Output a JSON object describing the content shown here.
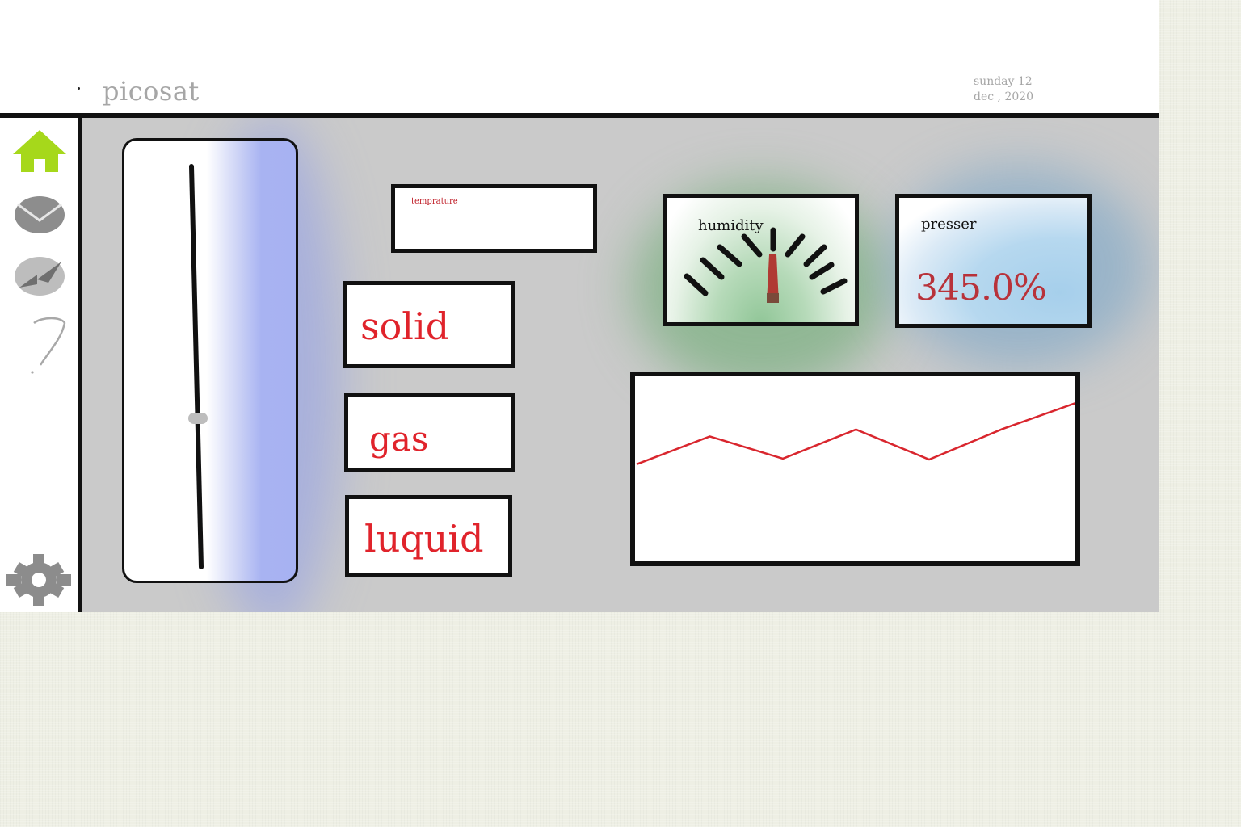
{
  "header": {
    "app_title": "picosat",
    "date_line1": "sunday 12",
    "date_line2": "dec , 2020"
  },
  "sidebar": {
    "items": [
      {
        "icon": "home-icon",
        "color": "#a6d81b"
      },
      {
        "icon": "mail-icon",
        "color": "#8a8a8a"
      },
      {
        "icon": "compass-icon",
        "color": "#8a8a8a"
      },
      {
        "icon": "question-icon",
        "color": "#8a8a8a"
      },
      {
        "icon": "gear-icon",
        "color": "#8a8a8a"
      }
    ]
  },
  "slider": {
    "level": 0.37
  },
  "temperature": {
    "label": "temprature"
  },
  "phases": {
    "solid": "solid",
    "gas": "gas",
    "liquid": "luquid"
  },
  "humidity": {
    "label": "humidity"
  },
  "pressure": {
    "label": "presser",
    "value": "345.0%"
  },
  "colors": {
    "accent_red": "#e0232b",
    "home_green": "#a6d81b",
    "slider_blue": "#a7b2f2",
    "humidity_green": "#8fc596",
    "pressure_blue": "#a6cfeb"
  },
  "chart_data": {
    "type": "line",
    "x": [
      0,
      1,
      2,
      3,
      4,
      5,
      6
    ],
    "values": [
      1,
      7,
      2.2,
      8.5,
      2,
      8.6,
      14.2
    ],
    "title": "",
    "xlabel": "",
    "ylabel": "",
    "ylim": [
      -20,
      20
    ],
    "grid": false,
    "series_color": "#d9262e"
  }
}
